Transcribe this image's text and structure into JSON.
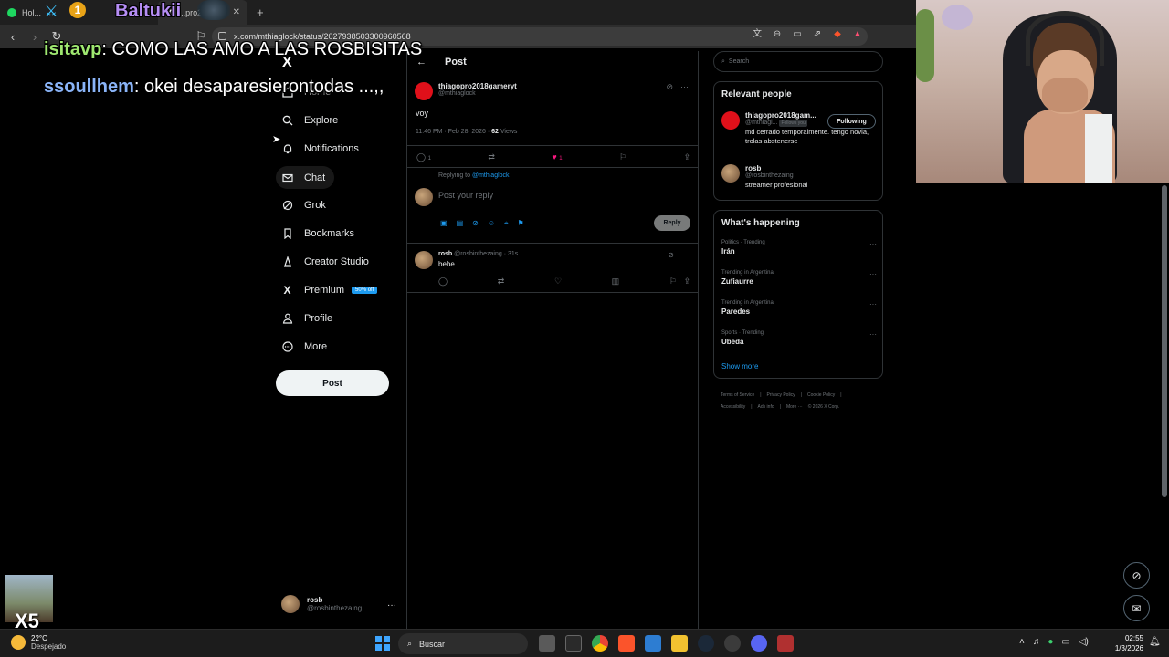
{
  "browser": {
    "tabs": [
      {
        "label": "Hol..."
      },
      {
        "label": "...pro2018gameryt on X: \"@..."
      }
    ],
    "url": "x.com/mthiaglock/status/2027938503300960568"
  },
  "overlay": {
    "streamer_name": "Baltukii",
    "badge": "1",
    "chat": [
      {
        "user": "isitavp",
        "message": ": COMO LAS AMO A LAS ROSBISITAS"
      },
      {
        "user": "ssoullhem",
        "message": ": okei desaparesierontodas ...,,"
      }
    ],
    "x5": "X5"
  },
  "nav": {
    "brand": "X",
    "items": [
      {
        "label": "Home",
        "icon": "home-icon"
      },
      {
        "label": "Explore",
        "icon": "search-icon"
      },
      {
        "label": "Notifications",
        "icon": "bell-icon"
      },
      {
        "label": "Chat",
        "icon": "mail-icon"
      },
      {
        "label": "Grok",
        "icon": "grok-icon"
      },
      {
        "label": "Bookmarks",
        "icon": "bookmark-icon"
      },
      {
        "label": "Creator Studio",
        "icon": "creator-icon"
      },
      {
        "label": "Premium",
        "icon": "x-icon"
      },
      {
        "label": "Profile",
        "icon": "person-icon"
      },
      {
        "label": "More",
        "icon": "more-circle-icon"
      }
    ],
    "premium_badge": "50% off",
    "post_button": "Post",
    "account": {
      "name": "rosb",
      "handle": "@rosbinthezaing",
      "more": "···"
    }
  },
  "main": {
    "header_title": "Post",
    "tweet": {
      "name": "thiagopro2018gameryt",
      "handle": "@mthiaglock",
      "text": "voy",
      "time": "11:46 PM · Feb 28, 2026 · ",
      "views_count": "62",
      "views_label": " Views",
      "reply_count": "1",
      "like_count": "1"
    },
    "replying_to_label": "Replying to ",
    "replying_to_handle": "@mthiaglock",
    "reply_placeholder": "Post your reply",
    "reply_button": "Reply",
    "reply": {
      "name": "rosb",
      "handle": "@rosbinthezaing · 31s",
      "text": "bebe"
    }
  },
  "sidebar": {
    "search_placeholder": "Search",
    "relevant_title": "Relevant people",
    "people": [
      {
        "name": "thiagopro2018gam...",
        "handle": "@mthiagl...",
        "follows_you": "Follows you",
        "bio": "md cerrado temporalmente. tengo novia, trolas abstenerse",
        "button": "Following"
      },
      {
        "name": "rosb",
        "handle": "@rosbinthezaing",
        "bio": "streamer profesional"
      }
    ],
    "happening_title": "What's happening",
    "trends": [
      {
        "meta": "Politics · Trending",
        "name": "Irán"
      },
      {
        "meta": "Trending in Argentina",
        "name": "Zufiaurre"
      },
      {
        "meta": "Trending in Argentina",
        "name": "Paredes"
      },
      {
        "meta": "Sports · Trending",
        "name": "Ubeda"
      }
    ],
    "show_more": "Show more",
    "footer": [
      "Terms of Service",
      "|",
      "Privacy Policy",
      "|",
      "Cookie Policy",
      "|",
      "Accessibility",
      "|",
      "Ads info",
      "|",
      "More ···",
      "© 2026 X Corp."
    ]
  },
  "taskbar": {
    "temperature": "22°C",
    "weather": "Despejado",
    "search_label": "Buscar",
    "time": "02:55",
    "date": "1/3/2026"
  },
  "colors": {
    "accent": "#1d9bf0",
    "like": "#f91880",
    "background": "#000000",
    "border": "#2f3336"
  }
}
